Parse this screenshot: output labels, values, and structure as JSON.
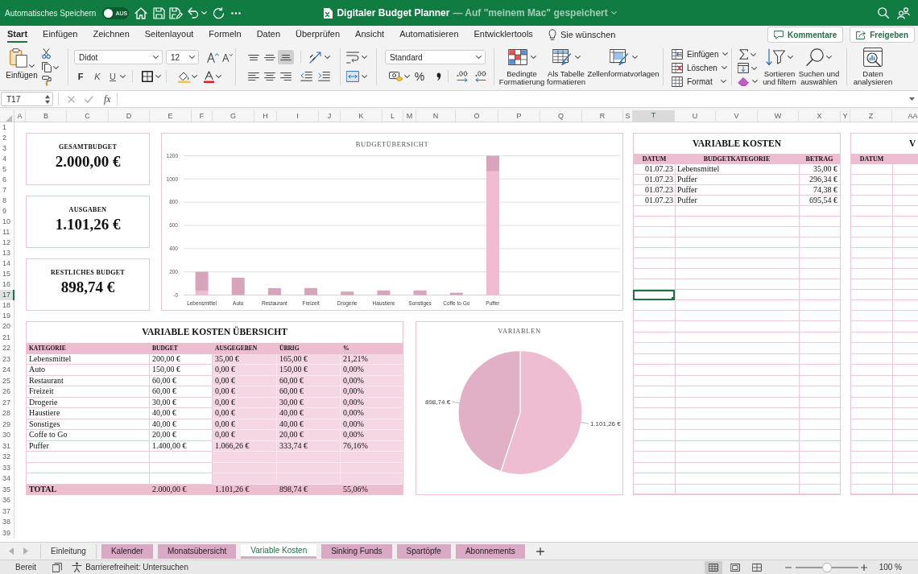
{
  "title_bar": {
    "autosave_label": "Automatisches Speichern",
    "autosave": {
      "on": false,
      "label": "AUS"
    },
    "document_title": "Digitaler Budget Planner",
    "save_location": "— Auf \"meinem Mac\" gespeichert"
  },
  "ribbon_tabs": [
    {
      "label": "Start",
      "selected": true
    },
    {
      "label": "Einfügen",
      "selected": false
    },
    {
      "label": "Zeichnen",
      "selected": false
    },
    {
      "label": "Seitenlayout",
      "selected": false
    },
    {
      "label": "Formeln",
      "selected": false
    },
    {
      "label": "Daten",
      "selected": false
    },
    {
      "label": "Überprüfen",
      "selected": false
    },
    {
      "label": "Ansicht",
      "selected": false
    },
    {
      "label": "Automatisieren",
      "selected": false
    },
    {
      "label": "Entwicklertools",
      "selected": false
    }
  ],
  "tell_me": "Sie wünschen",
  "header_buttons": {
    "comments": "Kommentare",
    "share": "Freigeben"
  },
  "ribbon": {
    "paste_label": "Einfügen",
    "font_name": "Didot",
    "font_size": "12",
    "bold_label": "F",
    "italic_label": "K",
    "underline_label": "U",
    "vertical_align": [
      {
        "selected": false
      },
      {
        "selected": false
      },
      {
        "selected": true
      }
    ],
    "number_format": "Standard",
    "percent_label": "%",
    "styles": [
      "Bedingte Formatierung",
      "Als Tabelle formatieren",
      "Zellenformatvorlagen"
    ],
    "cells": [
      "Einfügen",
      "Löschen",
      "Format"
    ],
    "sort_filter": "Sortieren und filtern",
    "find_select": "Suchen und auswählen",
    "analyze": "Daten analysieren"
  },
  "formula_bar": {
    "name_box": "T17",
    "function_label": "fx"
  },
  "columns": [
    {
      "label": "A",
      "selected": false
    },
    {
      "label": "B",
      "selected": false
    },
    {
      "label": "C",
      "selected": false
    },
    {
      "label": "D",
      "selected": false
    },
    {
      "label": "E",
      "selected": false
    },
    {
      "label": "F",
      "selected": false
    },
    {
      "label": "G",
      "selected": false
    },
    {
      "label": "H",
      "selected": false
    },
    {
      "label": "I",
      "selected": false
    },
    {
      "label": "J",
      "selected": false
    },
    {
      "label": "K",
      "selected": false
    },
    {
      "label": "L",
      "selected": false
    },
    {
      "label": "M",
      "selected": false
    },
    {
      "label": "N",
      "selected": false
    },
    {
      "label": "O",
      "selected": false
    },
    {
      "label": "P",
      "selected": false
    },
    {
      "label": "Q",
      "selected": false
    },
    {
      "label": "R",
      "selected": false
    },
    {
      "label": "S",
      "selected": false
    },
    {
      "label": "T",
      "selected": true
    },
    {
      "label": "U",
      "selected": false
    },
    {
      "label": "V",
      "selected": false
    },
    {
      "label": "W",
      "selected": false
    },
    {
      "label": "X",
      "selected": false
    },
    {
      "label": "Y",
      "selected": false
    },
    {
      "label": "Z",
      "selected": false
    },
    {
      "label": "AA",
      "selected": false
    }
  ],
  "rows": [
    {
      "label": "1",
      "selected": false
    },
    {
      "label": "2",
      "selected": false
    },
    {
      "label": "3",
      "selected": false
    },
    {
      "label": "4",
      "selected": false
    },
    {
      "label": "5",
      "selected": false
    },
    {
      "label": "6",
      "selected": false
    },
    {
      "label": "7",
      "selected": false
    },
    {
      "label": "8",
      "selected": false
    },
    {
      "label": "9",
      "selected": false
    },
    {
      "label": "10",
      "selected": false
    },
    {
      "label": "11",
      "selected": false
    },
    {
      "label": "12",
      "selected": false
    },
    {
      "label": "13",
      "selected": false
    },
    {
      "label": "14",
      "selected": false
    },
    {
      "label": "15",
      "selected": false
    },
    {
      "label": "16",
      "selected": false
    },
    {
      "label": "17",
      "selected": true
    },
    {
      "label": "18",
      "selected": false
    },
    {
      "label": "19",
      "selected": false
    },
    {
      "label": "20",
      "selected": false
    },
    {
      "label": "21",
      "selected": false
    },
    {
      "label": "22",
      "selected": false
    },
    {
      "label": "23",
      "selected": false
    },
    {
      "label": "24",
      "selected": false
    },
    {
      "label": "25",
      "selected": false
    },
    {
      "label": "26",
      "selected": false
    },
    {
      "label": "27",
      "selected": false
    },
    {
      "label": "28",
      "selected": false
    },
    {
      "label": "29",
      "selected": false
    },
    {
      "label": "30",
      "selected": false
    },
    {
      "label": "31",
      "selected": false
    },
    {
      "label": "32",
      "selected": false
    },
    {
      "label": "33",
      "selected": false
    },
    {
      "label": "34",
      "selected": false
    },
    {
      "label": "35",
      "selected": false
    },
    {
      "label": "36",
      "selected": false
    },
    {
      "label": "37",
      "selected": false
    },
    {
      "label": "38",
      "selected": false
    },
    {
      "label": "39",
      "selected": false
    }
  ],
  "summary_cards": [
    {
      "label": "GESAMTBUDGET",
      "value": "2.000,00 €"
    },
    {
      "label": "AUSGABEN",
      "value": "1.101,26 €"
    },
    {
      "label": "RESTLICHES BUDGET",
      "value": "898,74 €"
    }
  ],
  "budget_chart": {
    "chart_data": {
      "type": "bar",
      "title": "BUDGETÜBERSICHT",
      "categories": [
        "Lebensmittel",
        "Auto",
        "Restaurant",
        "Freizeit",
        "Drogerie",
        "Haustiere",
        "Sonstiges",
        "Coffe to Go",
        "Puffer"
      ],
      "series": [
        {
          "color": "#f1bcd1",
          "values": [
            35,
            0,
            0,
            0,
            0,
            0,
            0,
            0,
            1066
          ]
        },
        {
          "color": "#d7a4bc",
          "values": [
            165,
            150,
            60,
            60,
            30,
            40,
            40,
            20,
            134
          ]
        }
      ],
      "stacked": true,
      "grid": true,
      "ylim": [
        0,
        1200
      ],
      "yticks": [
        {
          "value": 0,
          "label": "-0"
        },
        200,
        400,
        600,
        800,
        1000,
        1200
      ]
    }
  },
  "overview_table": {
    "title": "VARIABLE KOSTEN ÜBERSICHT",
    "columns": [
      "KATEGORIE",
      "BUDGET",
      "AUSGEGEBEN",
      "ÜBRIG",
      "%"
    ],
    "rows": [
      [
        "Lebensmittel",
        "200,00 €",
        "35,00 €",
        "165,00 €",
        "21,21%"
      ],
      [
        "Auto",
        "150,00 €",
        "0,00 €",
        "150,00 €",
        "0,00%"
      ],
      [
        "Restaurant",
        "60,00 €",
        "0,00 €",
        "60,00 €",
        "0,00%"
      ],
      [
        "Freizeit",
        "60,00 €",
        "0,00 €",
        "60,00 €",
        "0,00%"
      ],
      [
        "Drogerie",
        "30,00 €",
        "0,00 €",
        "30,00 €",
        "0,00%"
      ],
      [
        "Haustiere",
        "40,00 €",
        "0,00 €",
        "40,00 €",
        "0,00%"
      ],
      [
        "Sonstiges",
        "40,00 €",
        "0,00 €",
        "40,00 €",
        "0,00%"
      ],
      [
        "Coffe to Go",
        "20,00 €",
        "0,00 €",
        "20,00 €",
        "0,00%"
      ],
      [
        "Puffer",
        "1.400,00 €",
        "1.066,26 €",
        "333,74 €",
        "76,16%"
      ]
    ],
    "total": [
      "TOTAL",
      "2.000,00 €",
      "1.101,26 €",
      "898,74 €",
      "55,06%"
    ]
  },
  "pie_chart": {
    "chart_data": {
      "type": "pie",
      "title": "VARIABLEN",
      "values": [
        1101.26,
        898.74
      ],
      "value_labels": [
        "1.101,26 €",
        "898,74 €"
      ]
    }
  },
  "expenses_table": {
    "title": "VARIABLE KOSTEN",
    "columns": [
      "DATUM",
      "BUDGETKATEGORIE",
      "BETRAG"
    ],
    "rows": [
      [
        "01.07.23",
        "Lebensmittel",
        "35,00 €"
      ],
      [
        "01.07.23",
        "Puffer",
        "296,34 €"
      ],
      [
        "01.07.23",
        "Puffer",
        "74,38 €"
      ],
      [
        "01.07.23",
        "Puffer",
        "695,54 €"
      ]
    ]
  },
  "second_table": {
    "title": "V",
    "columns": [
      "DATUM"
    ]
  },
  "sheet_tabs": [
    {
      "label": "Einleitung",
      "selected": false
    },
    {
      "label": "Kalender",
      "selected": false,
      "color": "#d9a8c4"
    },
    {
      "label": "Monatsübersicht",
      "selected": false,
      "color": "#d9a8c4"
    },
    {
      "label": "Variable Kosten",
      "selected": true,
      "color": "#d9a8c4"
    },
    {
      "label": "Sinking Funds",
      "selected": false,
      "color": "#d9a8c4"
    },
    {
      "label": "Spartöpfe",
      "selected": false,
      "color": "#d9a8c4"
    },
    {
      "label": "Abonnements",
      "selected": false,
      "color": "#d9a8c4"
    }
  ],
  "status_bar": {
    "status": "Bereit",
    "accessibility": "Barrierefreiheit: Untersuchen",
    "views": [
      {
        "selected": true
      },
      {
        "selected": false
      },
      {
        "selected": false
      }
    ],
    "zoom": {
      "level": 0.5,
      "label": "100 %"
    }
  }
}
